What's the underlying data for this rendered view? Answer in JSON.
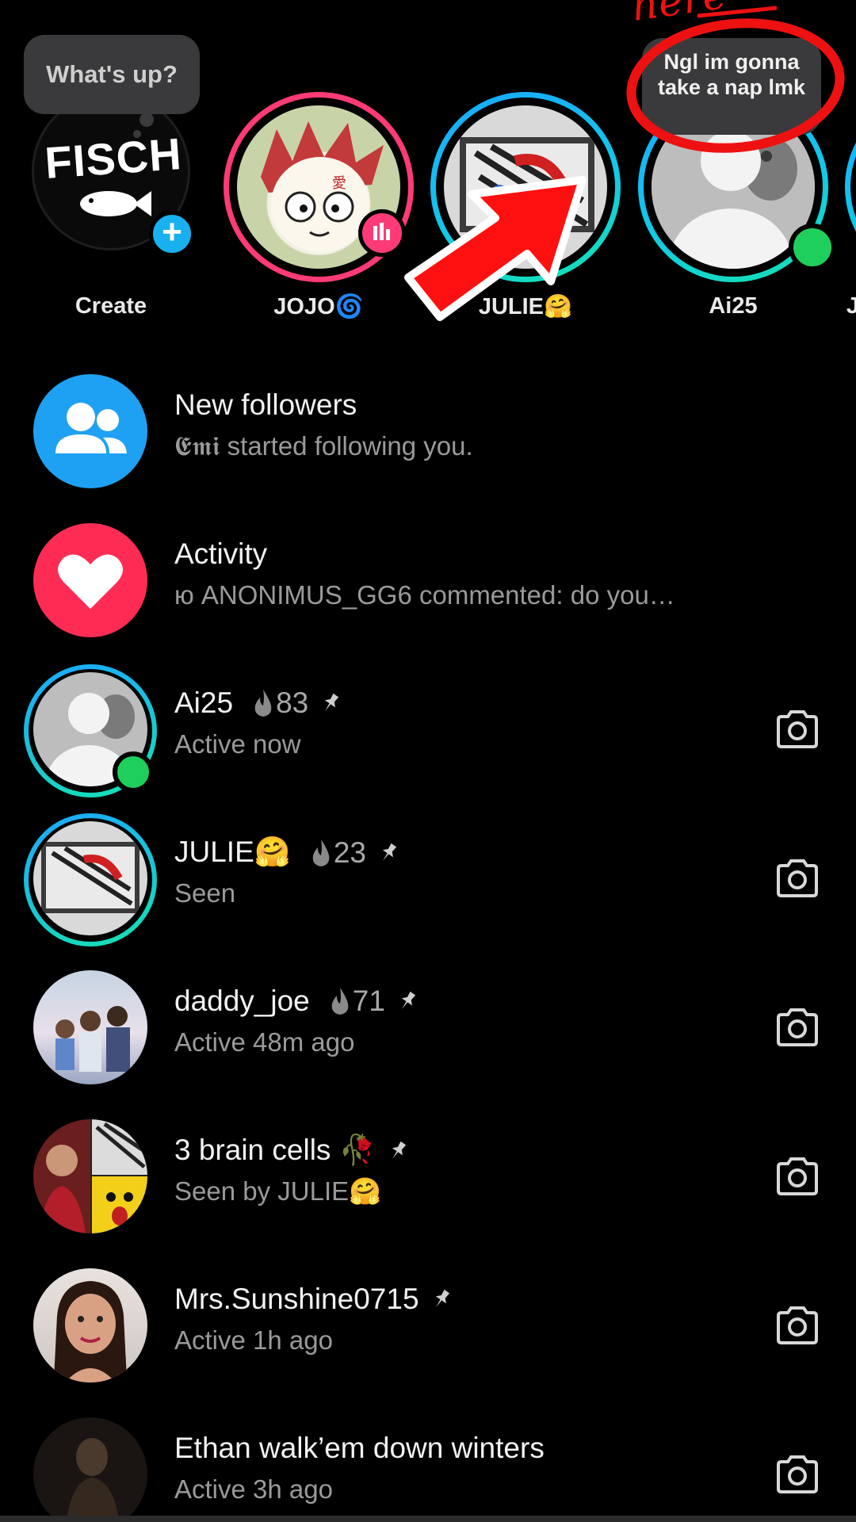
{
  "stories": {
    "status_bubble": "What's up?",
    "note_bubble": "Ngl im gonna take a nap lmk",
    "annotation_text": "here",
    "items": [
      {
        "name": "Create",
        "avatar_text": "FISCH"
      },
      {
        "name": "JOJO🌀"
      },
      {
        "name": "JULIE🤗"
      },
      {
        "name": "Ai25"
      },
      {
        "name": "J"
      }
    ]
  },
  "notifications": [
    {
      "title": "New followers",
      "subtitle": "𝕰𝖒𝖎 started following you.",
      "icon": "people-icon",
      "color": "#1ea1f2"
    },
    {
      "title": "Activity",
      "subtitle": "ю ANONIMUS_GG6 commented: do you…",
      "icon": "heart-icon",
      "color": "#fe2c55"
    }
  ],
  "chats": [
    {
      "name": "Ai25",
      "streak": "83",
      "pinned": true,
      "status": "Active now"
    },
    {
      "name": "JULIE🤗",
      "streak": "23",
      "pinned": true,
      "status": "Seen"
    },
    {
      "name": "daddy_joe",
      "streak": "71",
      "pinned": true,
      "status": "Active 48m ago"
    },
    {
      "name": "3 brain cells 🥀",
      "streak": "",
      "pinned": true,
      "status": "Seen by JULIE🤗"
    },
    {
      "name": "Mrs.Sunshine0715",
      "streak": "",
      "pinned": true,
      "status": "Active 1h ago"
    },
    {
      "name": "Ethan walk’em down winters",
      "streak": "",
      "pinned": false,
      "status": "Active 3h ago"
    }
  ],
  "colors": {
    "accent_blue": "#19b0f0",
    "accent_pink": "#ff3b77",
    "online": "#1fcf5c",
    "annotation_red": "#ee1111"
  }
}
